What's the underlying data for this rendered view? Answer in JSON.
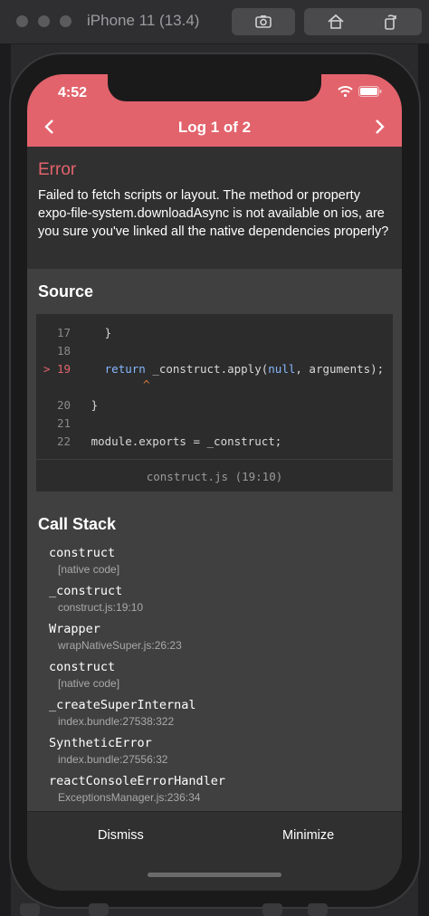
{
  "simulator": {
    "title": "iPhone 11 (13.4)",
    "buttons": [
      "screenshot-icon",
      "home-icon",
      "rotate-icon"
    ]
  },
  "status": {
    "time": "4:52"
  },
  "nav": {
    "title": "Log 1 of 2",
    "back_icon": "chevron-left-icon",
    "next_icon": "chevron-right-icon"
  },
  "error": {
    "title": "Error",
    "message": "Failed to fetch scripts or layout. The method or property expo-file-system.downloadAsync is not available on ios, are you sure you've linked all the native dependencies properly?"
  },
  "source": {
    "title": "Source",
    "lines": [
      {
        "num": "17",
        "code": "  }"
      },
      {
        "num": "18",
        "code": ""
      },
      {
        "num": "19",
        "marker": ">",
        "pre": "  ",
        "kw1": "return",
        "mid": " _construct.apply(",
        "kw2": "null",
        "post": ", arguments);"
      },
      {
        "num": "20",
        "code": "}"
      },
      {
        "num": "21",
        "code": ""
      },
      {
        "num": "22",
        "code": "module.exports = _construct;"
      }
    ],
    "caret": "^",
    "footer": "construct.js (19:10)"
  },
  "call_stack": {
    "title": "Call Stack",
    "items": [
      {
        "fn": "construct",
        "loc": "[native code]"
      },
      {
        "fn": "_construct",
        "loc": "construct.js:19:10"
      },
      {
        "fn": "Wrapper",
        "loc": "wrapNativeSuper.js:26:23"
      },
      {
        "fn": "construct",
        "loc": "[native code]"
      },
      {
        "fn": "_createSuperInternal",
        "loc": "index.bundle:27538:322"
      },
      {
        "fn": "SyntheticError",
        "loc": "index.bundle:27556:32"
      },
      {
        "fn": "reactConsoleErrorHandler",
        "loc": "ExceptionsManager.js:236:34"
      }
    ]
  },
  "bottom": {
    "dismiss": "Dismiss",
    "minimize": "Minimize"
  },
  "colors": {
    "accent": "#e2636c",
    "background": "#333333",
    "panel": "#404040"
  }
}
